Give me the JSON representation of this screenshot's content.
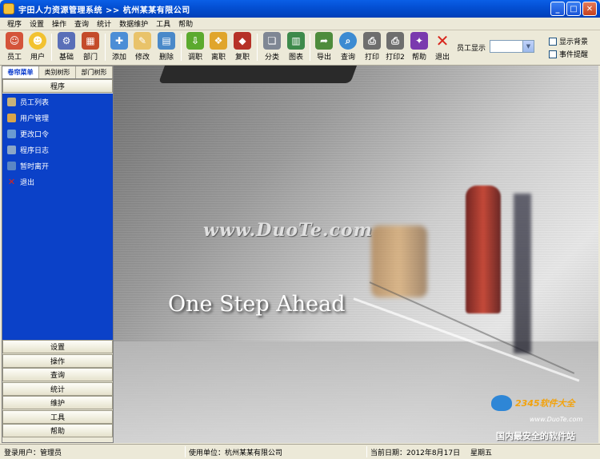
{
  "window": {
    "title": "宇田人力资源管理系统 >> 杭州某某有限公司"
  },
  "menu": [
    "程序",
    "设置",
    "操作",
    "查询",
    "统计",
    "数据维护",
    "工具",
    "帮助"
  ],
  "toolbar": {
    "buttons": [
      {
        "label": "员工",
        "icon": "employee-icon",
        "color": "#D4543A"
      },
      {
        "label": "用户",
        "icon": "smiley-user-icon",
        "color": "#F2C230"
      },
      {
        "label": "基础",
        "icon": "gears-icon",
        "color": "#5A6FB8"
      },
      {
        "label": "部门",
        "icon": "department-icon",
        "color": "#C44B2A"
      },
      {
        "label": "添加",
        "icon": "add-document-icon",
        "color": "#4C8ED6"
      },
      {
        "label": "修改",
        "icon": "edit-document-icon",
        "color": "#E9C36A"
      },
      {
        "label": "删除",
        "icon": "delete-image-icon",
        "color": "#4A89C9"
      },
      {
        "label": "调职",
        "icon": "transfer-arrow-icon",
        "color": "#5BAA2E"
      },
      {
        "label": "离职",
        "icon": "resign-box-icon",
        "color": "#E0A52B"
      },
      {
        "label": "复职",
        "icon": "rehire-icon",
        "color": "#B63228"
      },
      {
        "label": "分类",
        "icon": "category-pages-icon",
        "color": "#7F8794"
      },
      {
        "label": "图表",
        "icon": "chart-icon",
        "color": "#3D8A4B"
      },
      {
        "label": "导出",
        "icon": "export-icon",
        "color": "#4E8C3C"
      },
      {
        "label": "查询",
        "icon": "magnifier-icon",
        "color": "#3C8BD2"
      },
      {
        "label": "打印",
        "icon": "printer-icon",
        "color": "#6E6E6E"
      },
      {
        "label": "打印2",
        "icon": "printer2-icon",
        "color": "#6E6E6E"
      },
      {
        "label": "帮助",
        "icon": "help-icon",
        "color": "#7A3AAE"
      },
      {
        "label": "退出",
        "icon": "exit-x-icon",
        "color": "#D8261C"
      }
    ],
    "employee_display_label": "员工显示",
    "employee_display_value": "",
    "checkboxes": [
      {
        "label": "显示背景",
        "checked": false
      },
      {
        "label": "事件提醒",
        "checked": false
      }
    ]
  },
  "left_panel": {
    "tabs": [
      "卷帘菜单",
      "类别树形",
      "部门树形"
    ],
    "active_group": "程序",
    "items": [
      {
        "label": "员工列表",
        "icon": "employee-list-icon",
        "color": "#C7B27A"
      },
      {
        "label": "用户管理",
        "icon": "user-manage-icon",
        "color": "#D9A54A"
      },
      {
        "label": "更改口令",
        "icon": "change-password-icon",
        "color": "#6A9BD1"
      },
      {
        "label": "程序日志",
        "icon": "program-log-icon",
        "color": "#8BA7C7"
      },
      {
        "label": "暂时离开",
        "icon": "away-icon",
        "color": "#5B86C4"
      },
      {
        "label": "退出",
        "icon": "exit-icon",
        "color": "#D8261C"
      }
    ],
    "bottom_groups": [
      "设置",
      "操作",
      "查询",
      "统计",
      "维护",
      "工具",
      "帮助"
    ]
  },
  "main": {
    "watermark": "www.DuoTe.com",
    "slogan": "One Step Ahead",
    "corner_brand": "2345软件大全",
    "corner_site": "www.DuoTe.com",
    "corner_tagline": "国内最安全的软件站"
  },
  "status_bar": {
    "user": "登录用户：管理员",
    "unit": "使用单位：杭州某某有限公司",
    "date": "当前日期：2012年8月17日",
    "weekday": "星期五"
  }
}
